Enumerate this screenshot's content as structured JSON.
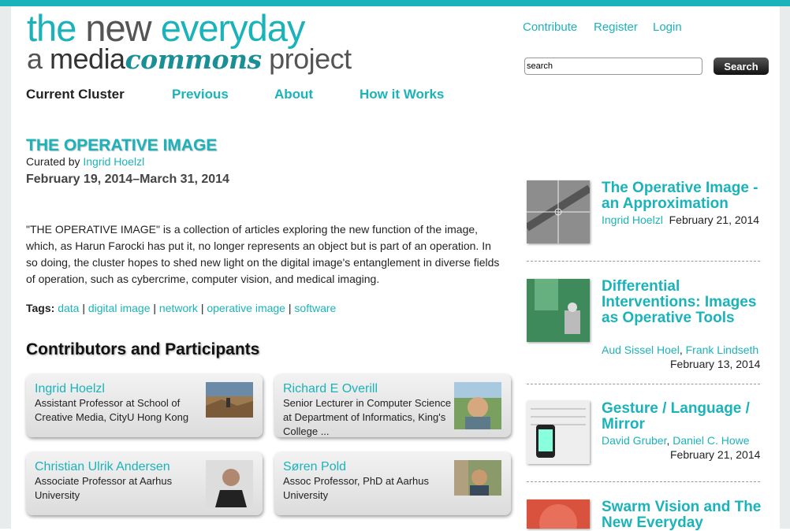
{
  "header": {
    "logo_line1_a": "the ",
    "logo_line1_b": "new ",
    "logo_line1_c": "everyday",
    "logo_line2_a": "a ",
    "logo_line2_b": "media",
    "logo_line2_c": "commons",
    "logo_line2_d": " project",
    "links": [
      "Contribute",
      "Register",
      "Login"
    ],
    "search_placeholder": "search",
    "search_button": "Search"
  },
  "nav": [
    "Current Cluster",
    "Previous",
    "About",
    "How it Works"
  ],
  "cluster": {
    "title": "THE OPERATIVE IMAGE",
    "curated_prefix": "Curated by ",
    "curator": "Ingrid Hoelzl",
    "dates": "February 19, 2014–March 31, 2014",
    "description": "\"THE OPERATIVE IMAGE\" is a collection of articles exploring the new function of the image, which, as Harun Farocki has put it, no longer represents an object but is part of an operation. In so doing, the cluster hopes to shed new light on the digital image's entanglement in diverse fields of operation, such as cybercrime, computer vision, and medical imaging.",
    "tags_label": "Tags:",
    "tags": [
      "data",
      "digital image",
      "network",
      "operative image",
      "software"
    ]
  },
  "contributors_heading": "Contributors and Participants",
  "contributors": [
    {
      "name": "Ingrid Hoelzl",
      "role": "Assistant Professor at School of Creative Media, CityU Hong Kong"
    },
    {
      "name": "Richard E Overill",
      "role": "Senior Lecturer in Computer Science at Department of Informatics, King's College ..."
    },
    {
      "name": "Christian Ulrik Andersen",
      "role": "Associate Professor at Aarhus University"
    },
    {
      "name": "Søren Pold",
      "role": "Assoc Professor, PhD at Aarhus University"
    }
  ],
  "articles": [
    {
      "title": "The Operative Image - an Approximation",
      "authors": [
        "Ingrid Hoelzl"
      ],
      "date": "February 21, 2014"
    },
    {
      "title": "Differential Interventions: Images as Operative Tools",
      "authors": [
        "Aud Sissel Hoel",
        "Frank Lindseth"
      ],
      "date": "February 13, 2014"
    },
    {
      "title": "Gesture / Language / Mirror",
      "authors": [
        "David Gruber",
        "Daniel C. Howe"
      ],
      "date": "February 21, 2014"
    },
    {
      "title": "Swarm Vision and The New Everyday",
      "authors": [],
      "date": ""
    }
  ],
  "colors": {
    "accent": "#1bb3ba",
    "text": "#222222"
  }
}
